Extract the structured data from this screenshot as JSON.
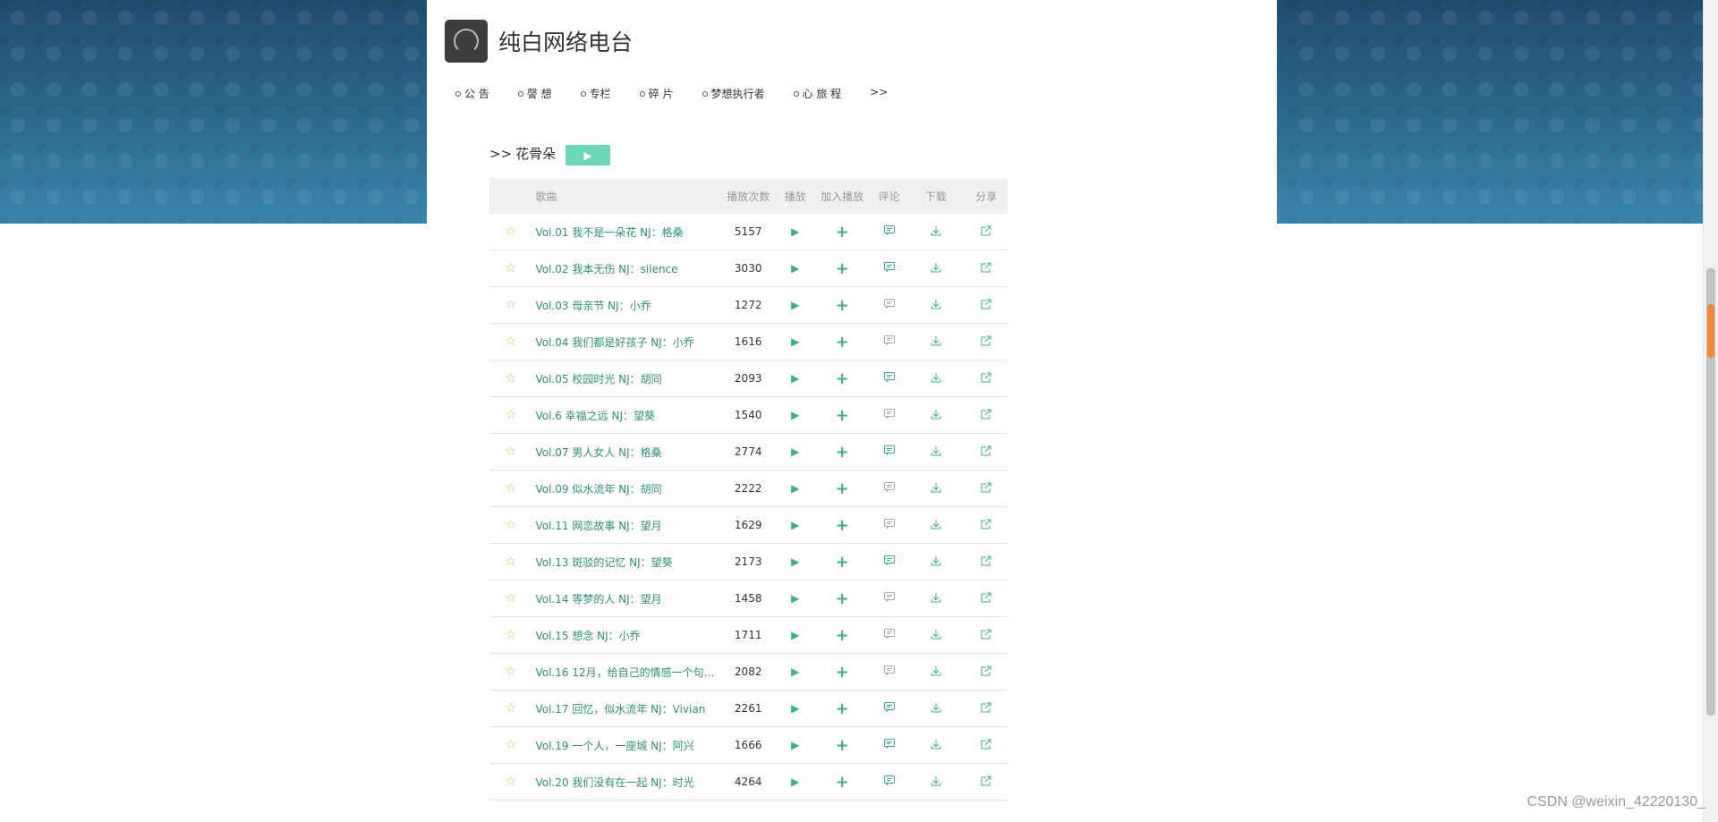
{
  "site": {
    "title": "纯白网络电台"
  },
  "nav": {
    "items": [
      "公 告",
      "謦 想",
      "专栏",
      "碎 片",
      "梦想执行者",
      "心 旅 程"
    ],
    "more": ">>"
  },
  "album": {
    "prefix": ">>",
    "title": "花骨朵",
    "play_symbol": "▶"
  },
  "table": {
    "headers": {
      "title": "歌曲",
      "plays": "播放次数",
      "play": "播放",
      "add": "加入播放",
      "comment": "评论",
      "download": "下载",
      "share": "分享"
    },
    "rows": [
      {
        "title": "Vol.01 我不是一朵花 NJ：格桑",
        "plays": "5157",
        "comment_active": true
      },
      {
        "title": "Vol.02 我本无伤 NJ：silence",
        "plays": "3030",
        "comment_active": true
      },
      {
        "title": "Vol.03 母亲节 NJ：小乔",
        "plays": "1272",
        "comment_active": false
      },
      {
        "title": "Vol.04 我们都是好孩子 NJ：小乔",
        "plays": "1616",
        "comment_active": false
      },
      {
        "title": "Vol.05 校园时光 NJ：胡同",
        "plays": "2093",
        "comment_active": true
      },
      {
        "title": "Vol.6 幸福之远 NJ：望葵",
        "plays": "1540",
        "comment_active": false
      },
      {
        "title": "Vol.07 男人女人 NJ：格桑",
        "plays": "2774",
        "comment_active": true
      },
      {
        "title": "Vol.09 似水流年 NJ：胡同",
        "plays": "2222",
        "comment_active": false
      },
      {
        "title": "Vol.11 网恋故事 NJ：望月",
        "plays": "1629",
        "comment_active": false
      },
      {
        "title": "Vol.13 斑驳的记忆 NJ：望葵",
        "plays": "2173",
        "comment_active": true
      },
      {
        "title": "Vol.14 等梦的人 NJ：望月",
        "plays": "1458",
        "comment_active": false
      },
      {
        "title": "Vol.15 想念 NJ：小乔",
        "plays": "1711",
        "comment_active": false
      },
      {
        "title": "Vol.16 12月，给自己的情感一个句号...",
        "plays": "2082",
        "comment_active": false
      },
      {
        "title": "Vol.17 回忆，似水流年 NJ：Vivian",
        "plays": "2261",
        "comment_active": true
      },
      {
        "title": "Vol.19 一个人，一座城 NJ：阿兴",
        "plays": "1666",
        "comment_active": true
      },
      {
        "title": "Vol.20 我们没有在一起 NJ：时光",
        "plays": "4264",
        "comment_active": true
      }
    ]
  },
  "watermark": "CSDN @weixin_42220130_",
  "colors": {
    "accent": "#3fae8c",
    "play_button": "#6ed5b8",
    "star": "#f3ae3d",
    "banner": "#2f6f96"
  }
}
